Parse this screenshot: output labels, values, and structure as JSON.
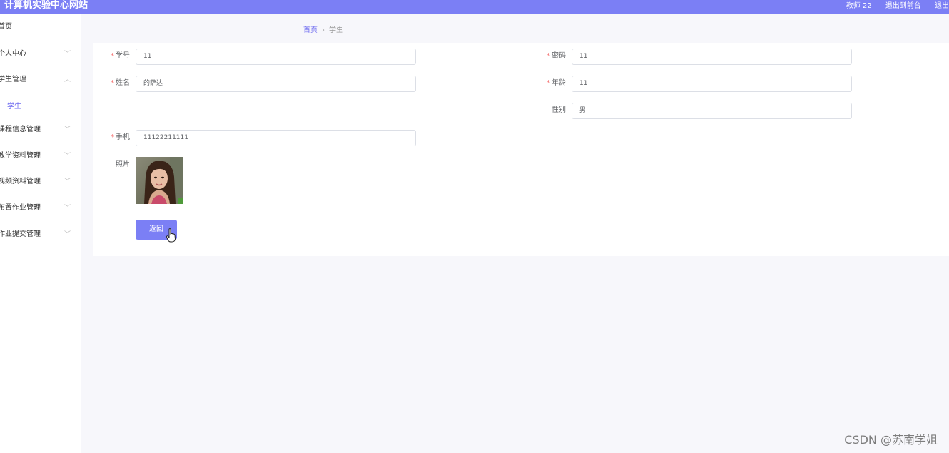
{
  "app": {
    "title": "计算机实验中心网站"
  },
  "topbar": {
    "user": "教师 22",
    "exit_front": "退出到前台",
    "logout": "退出"
  },
  "sidebar": {
    "items": [
      {
        "label": "首页",
        "has_chevron": false
      },
      {
        "label": "个人中心",
        "has_chevron": true
      },
      {
        "label": "学生管理",
        "has_chevron": true,
        "expanded": true
      },
      {
        "label": "课程信息管理",
        "has_chevron": true
      },
      {
        "label": "教学资料管理",
        "has_chevron": true
      },
      {
        "label": "视频资料管理",
        "has_chevron": true
      },
      {
        "label": "布置作业管理",
        "has_chevron": true
      },
      {
        "label": "作业提交管理",
        "has_chevron": true
      }
    ],
    "sub_item": "学生"
  },
  "breadcrumb": {
    "home": "首页",
    "current": "学生"
  },
  "form": {
    "student_id": {
      "label": "学号",
      "value": "11",
      "required": true
    },
    "password": {
      "label": "密码",
      "value": "11",
      "required": true
    },
    "name": {
      "label": "姓名",
      "value": "的萨达",
      "required": true
    },
    "age": {
      "label": "年龄",
      "value": "11",
      "required": true
    },
    "gender": {
      "label": "性别",
      "value": "男",
      "required": false
    },
    "phone": {
      "label": "手机",
      "value": "11122211111",
      "required": true
    },
    "photo": {
      "label": "照片"
    }
  },
  "buttons": {
    "back": "返回"
  },
  "watermark": "CSDN @苏南学姐",
  "colors": {
    "accent": "#7b7ff5",
    "required": "#f56c6c"
  }
}
